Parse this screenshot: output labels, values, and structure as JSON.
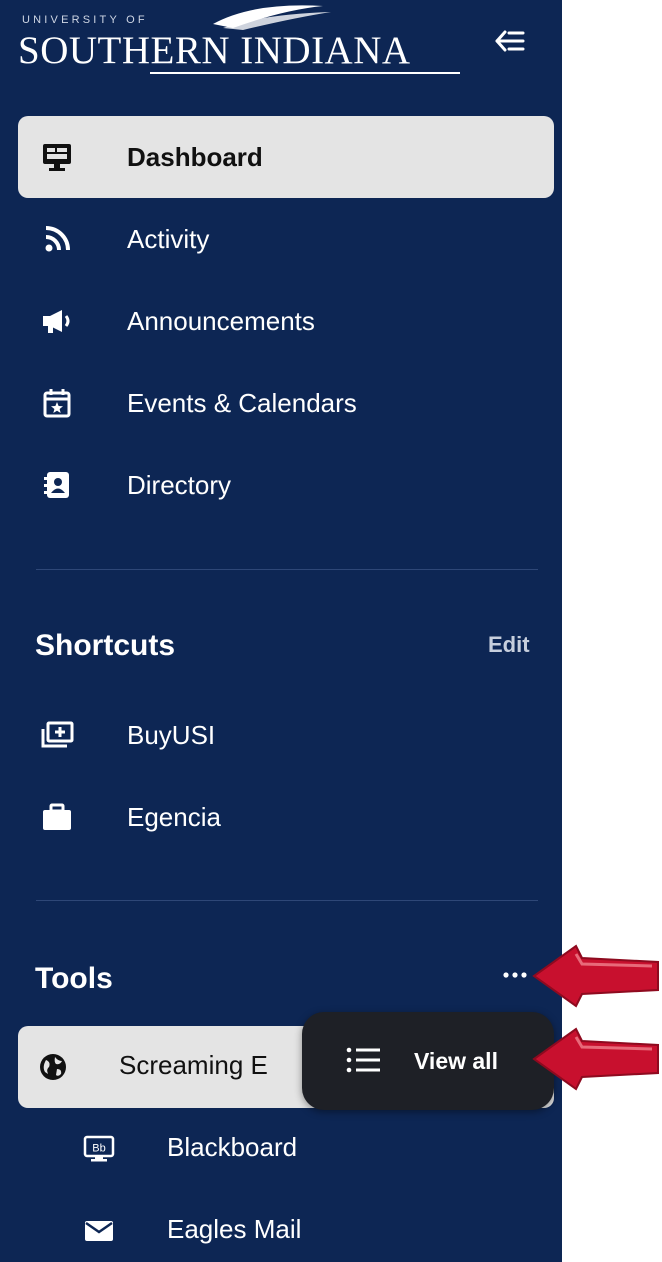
{
  "logo": {
    "small_text": "UNIVERSITY OF",
    "big_text": "SOUTHERN INDIANA"
  },
  "icons": {
    "collapse": "collapse-sidebar-icon",
    "dashboard": "monitor-icon",
    "activity": "rss-feed-icon",
    "announcements": "megaphone-icon",
    "events": "calendar-star-icon",
    "directory": "contact-book-icon",
    "buyusi": "money-add-icon",
    "egencia": "briefcase-icon",
    "screaming": "globe-icon",
    "blackboard": "blackboard-bb-icon",
    "mail": "envelope-icon",
    "more": "ellipsis-icon",
    "view_all": "list-icon"
  },
  "nav": {
    "items": [
      {
        "label": "Dashboard",
        "active": true
      },
      {
        "label": "Activity"
      },
      {
        "label": "Announcements"
      },
      {
        "label": "Events & Calendars"
      },
      {
        "label": "Directory"
      }
    ]
  },
  "shortcuts": {
    "title": "Shortcuts",
    "edit_label": "Edit",
    "items": [
      {
        "label": "BuyUSI"
      },
      {
        "label": "Egencia"
      }
    ]
  },
  "tools": {
    "title": "Tools",
    "more_label": "...",
    "items": [
      {
        "label": "Screaming E"
      },
      {
        "label": "Blackboard"
      },
      {
        "label": "Eagles Mail"
      }
    ]
  },
  "popup": {
    "view_all_label": "View all"
  },
  "colors": {
    "sidebar_bg": "#0d2654",
    "active_bg": "#e4e4e4",
    "popup_bg": "#1e2026",
    "arrow_red": "#c8102e"
  }
}
